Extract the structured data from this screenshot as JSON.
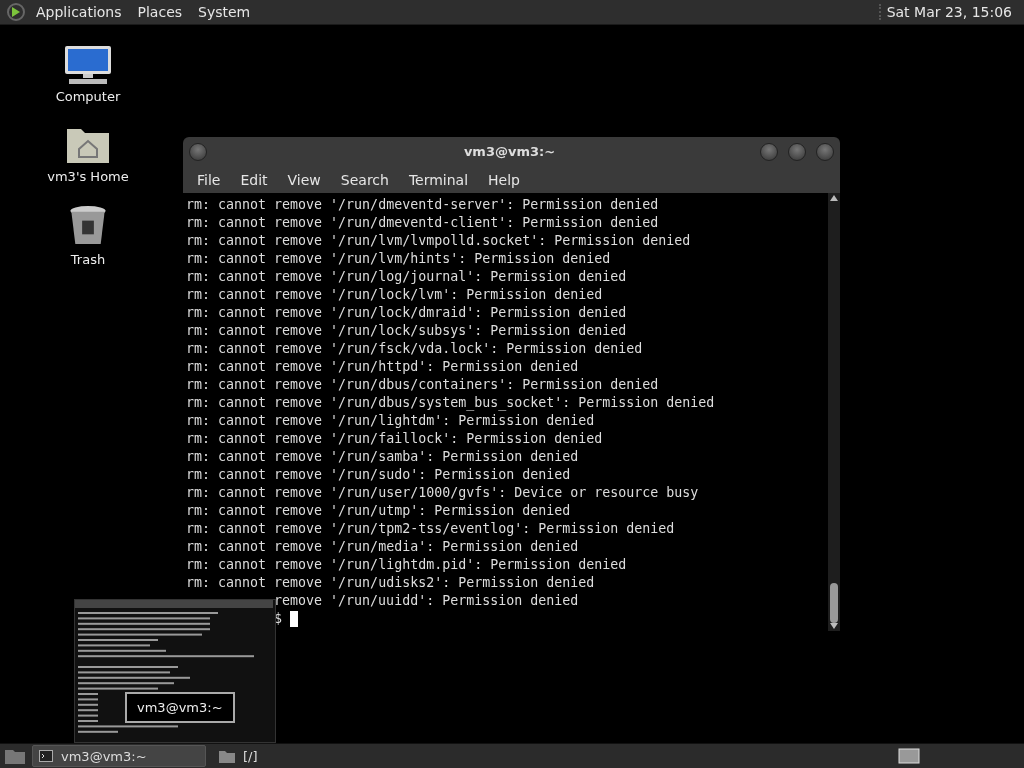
{
  "top_panel": {
    "menus": [
      "Applications",
      "Places",
      "System"
    ],
    "clock": "Sat Mar 23, 15:06"
  },
  "desktop_icons": [
    {
      "kind": "computer",
      "label": "Computer"
    },
    {
      "kind": "home",
      "label": "vm3's Home"
    },
    {
      "kind": "trash",
      "label": "Trash"
    }
  ],
  "terminal": {
    "title": "vm3@vm3:~",
    "menu": [
      "File",
      "Edit",
      "View",
      "Search",
      "Terminal",
      "Help"
    ],
    "lines": [
      "rm: cannot remove '/run/dmeventd-server': Permission denied",
      "rm: cannot remove '/run/dmeventd-client': Permission denied",
      "rm: cannot remove '/run/lvm/lvmpolld.socket': Permission denied",
      "rm: cannot remove '/run/lvm/hints': Permission denied",
      "rm: cannot remove '/run/log/journal': Permission denied",
      "rm: cannot remove '/run/lock/lvm': Permission denied",
      "rm: cannot remove '/run/lock/dmraid': Permission denied",
      "rm: cannot remove '/run/lock/subsys': Permission denied",
      "rm: cannot remove '/run/fsck/vda.lock': Permission denied",
      "rm: cannot remove '/run/httpd': Permission denied",
      "rm: cannot remove '/run/dbus/containers': Permission denied",
      "rm: cannot remove '/run/dbus/system_bus_socket': Permission denied",
      "rm: cannot remove '/run/lightdm': Permission denied",
      "rm: cannot remove '/run/faillock': Permission denied",
      "rm: cannot remove '/run/samba': Permission denied",
      "rm: cannot remove '/run/sudo': Permission denied",
      "rm: cannot remove '/run/user/1000/gvfs': Device or resource busy",
      "rm: cannot remove '/run/utmp': Permission denied",
      "rm: cannot remove '/run/tpm2-tss/eventlog': Permission denied",
      "rm: cannot remove '/run/media': Permission denied",
      "rm: cannot remove '/run/lightdm.pid': Permission denied",
      "rm: cannot remove '/run/udisks2': Permission denied"
    ],
    "partly_covered_lines": [
      "remove '/run/uuidd': Permission denied",
      "$"
    ]
  },
  "preview_popup": {
    "tooltip": "vm3@vm3:~"
  },
  "taskbar": {
    "tasks": [
      {
        "kind": "terminal",
        "label": "vm3@vm3:~",
        "selected": true
      },
      {
        "kind": "folder",
        "label": "[/]",
        "selected": false
      }
    ]
  }
}
